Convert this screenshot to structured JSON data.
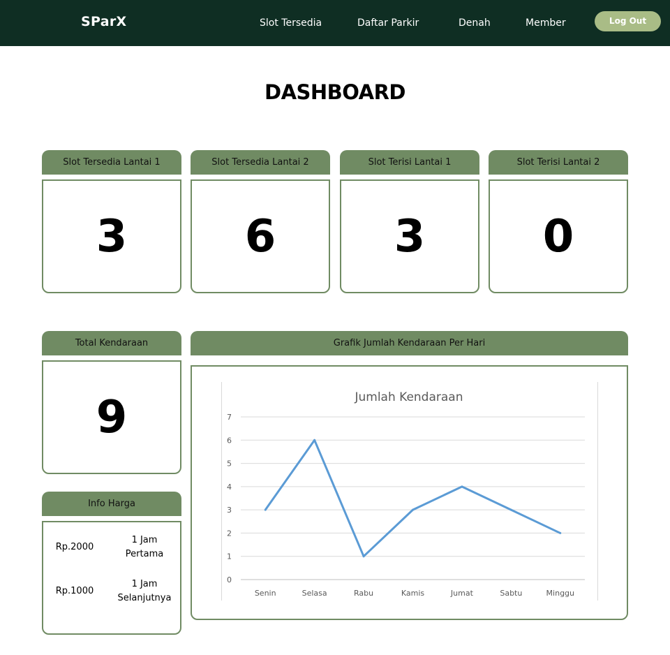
{
  "navbar": {
    "brand": "SParX",
    "links": [
      "Slot Tersedia",
      "Daftar Parkir",
      "Denah",
      "Member"
    ],
    "logout_label": "Log Out"
  },
  "page": {
    "title": "DASHBOARD"
  },
  "stats": [
    {
      "label": "Slot Tersedia Lantai 1",
      "value": "3"
    },
    {
      "label": "Slot Tersedia Lantai 2",
      "value": "6"
    },
    {
      "label": "Slot Terisi Lantai 1",
      "value": "3"
    },
    {
      "label": "Slot Terisi Lantai 2",
      "value": "0"
    }
  ],
  "total": {
    "label": "Total Kendaraan",
    "value": "9"
  },
  "prices": {
    "label": "Info Harga",
    "rows": [
      {
        "price": "Rp.2000",
        "desc_line1": "1 Jam",
        "desc_line2": "Pertama"
      },
      {
        "price": "Rp.1000",
        "desc_line1": "1 Jam",
        "desc_line2": "Selanjutnya"
      }
    ]
  },
  "chart_panel": {
    "label": "Grafik Jumlah Kendaraan Per Hari"
  },
  "colors": {
    "navbar": "#0f2e23",
    "accent": "#708b63",
    "logout": "#a9bc86",
    "line": "#5b9bd5"
  },
  "chart_data": {
    "type": "line",
    "title": "Jumlah Kendaraan",
    "categories": [
      "Senin",
      "Selasa",
      "Rabu",
      "Kamis",
      "Jumat",
      "Sabtu",
      "Minggu"
    ],
    "values": [
      3,
      6,
      1,
      3,
      4,
      3,
      2
    ],
    "ylim": [
      0,
      7
    ],
    "yticks": [
      0,
      1,
      2,
      3,
      4,
      5,
      6,
      7
    ],
    "grid": true,
    "legend": "none"
  }
}
